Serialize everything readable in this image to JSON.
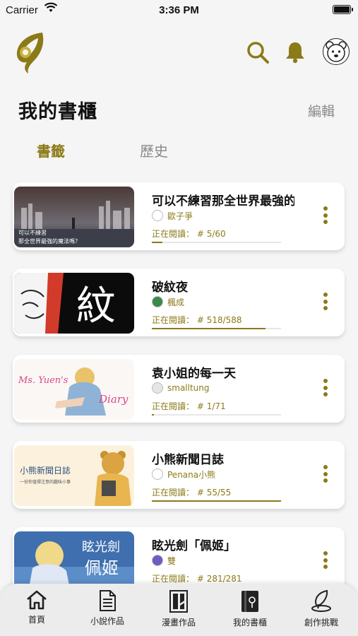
{
  "status_bar": {
    "carrier": "Carrier",
    "time": "3:36 PM"
  },
  "header": {
    "title": "我的書櫃",
    "edit_label": "編輯"
  },
  "tabs": [
    {
      "label": "書籤",
      "active": true
    },
    {
      "label": "歷史",
      "active": false
    }
  ],
  "cover_text": {
    "book1": [
      "可以不練習",
      "那全世界最強的魔法嗎？"
    ],
    "book2": "紋",
    "book3": [
      "Ms. Yuen's",
      "Diary"
    ],
    "book4": [
      "小熊新聞日誌",
      "一份你值得注意的趣味小事"
    ],
    "book5": [
      "眩光劍",
      "佩姬"
    ]
  },
  "books": [
    {
      "title": "可以不練習那全世界最強的",
      "author": "歐子爭",
      "reading_label": "正在閱讀：",
      "progress_text": "# 5/60",
      "progress": 0.083
    },
    {
      "title": "破紋夜",
      "author": "楓成",
      "reading_label": "正在閱讀：",
      "progress_text": "# 518/588",
      "progress": 0.881
    },
    {
      "title": "袁小姐的每一天",
      "author": "smalltung",
      "reading_label": "正在閱讀：",
      "progress_text": "# 1/71",
      "progress": 0.014
    },
    {
      "title": "小熊新聞日誌",
      "author": "Penana小熊",
      "reading_label": "正在閱讀：",
      "progress_text": "# 55/55",
      "progress": 1.0
    },
    {
      "title": "眩光劍「佩姬」",
      "author": "雙",
      "reading_label": "正在閱讀：",
      "progress_text": "# 281/281",
      "progress": 1.0
    }
  ],
  "nav": [
    {
      "label": "首頁",
      "icon": "home-icon"
    },
    {
      "label": "小說作品",
      "icon": "novel-icon"
    },
    {
      "label": "漫畫作品",
      "icon": "comic-icon"
    },
    {
      "label": "我的書櫃",
      "icon": "bookshelf-icon"
    },
    {
      "label": "創作挑戰",
      "icon": "quill-icon"
    }
  ],
  "colors": {
    "accent": "#8b7a18",
    "muted": "#8a8a8a",
    "nav_bg": "#ececec"
  }
}
